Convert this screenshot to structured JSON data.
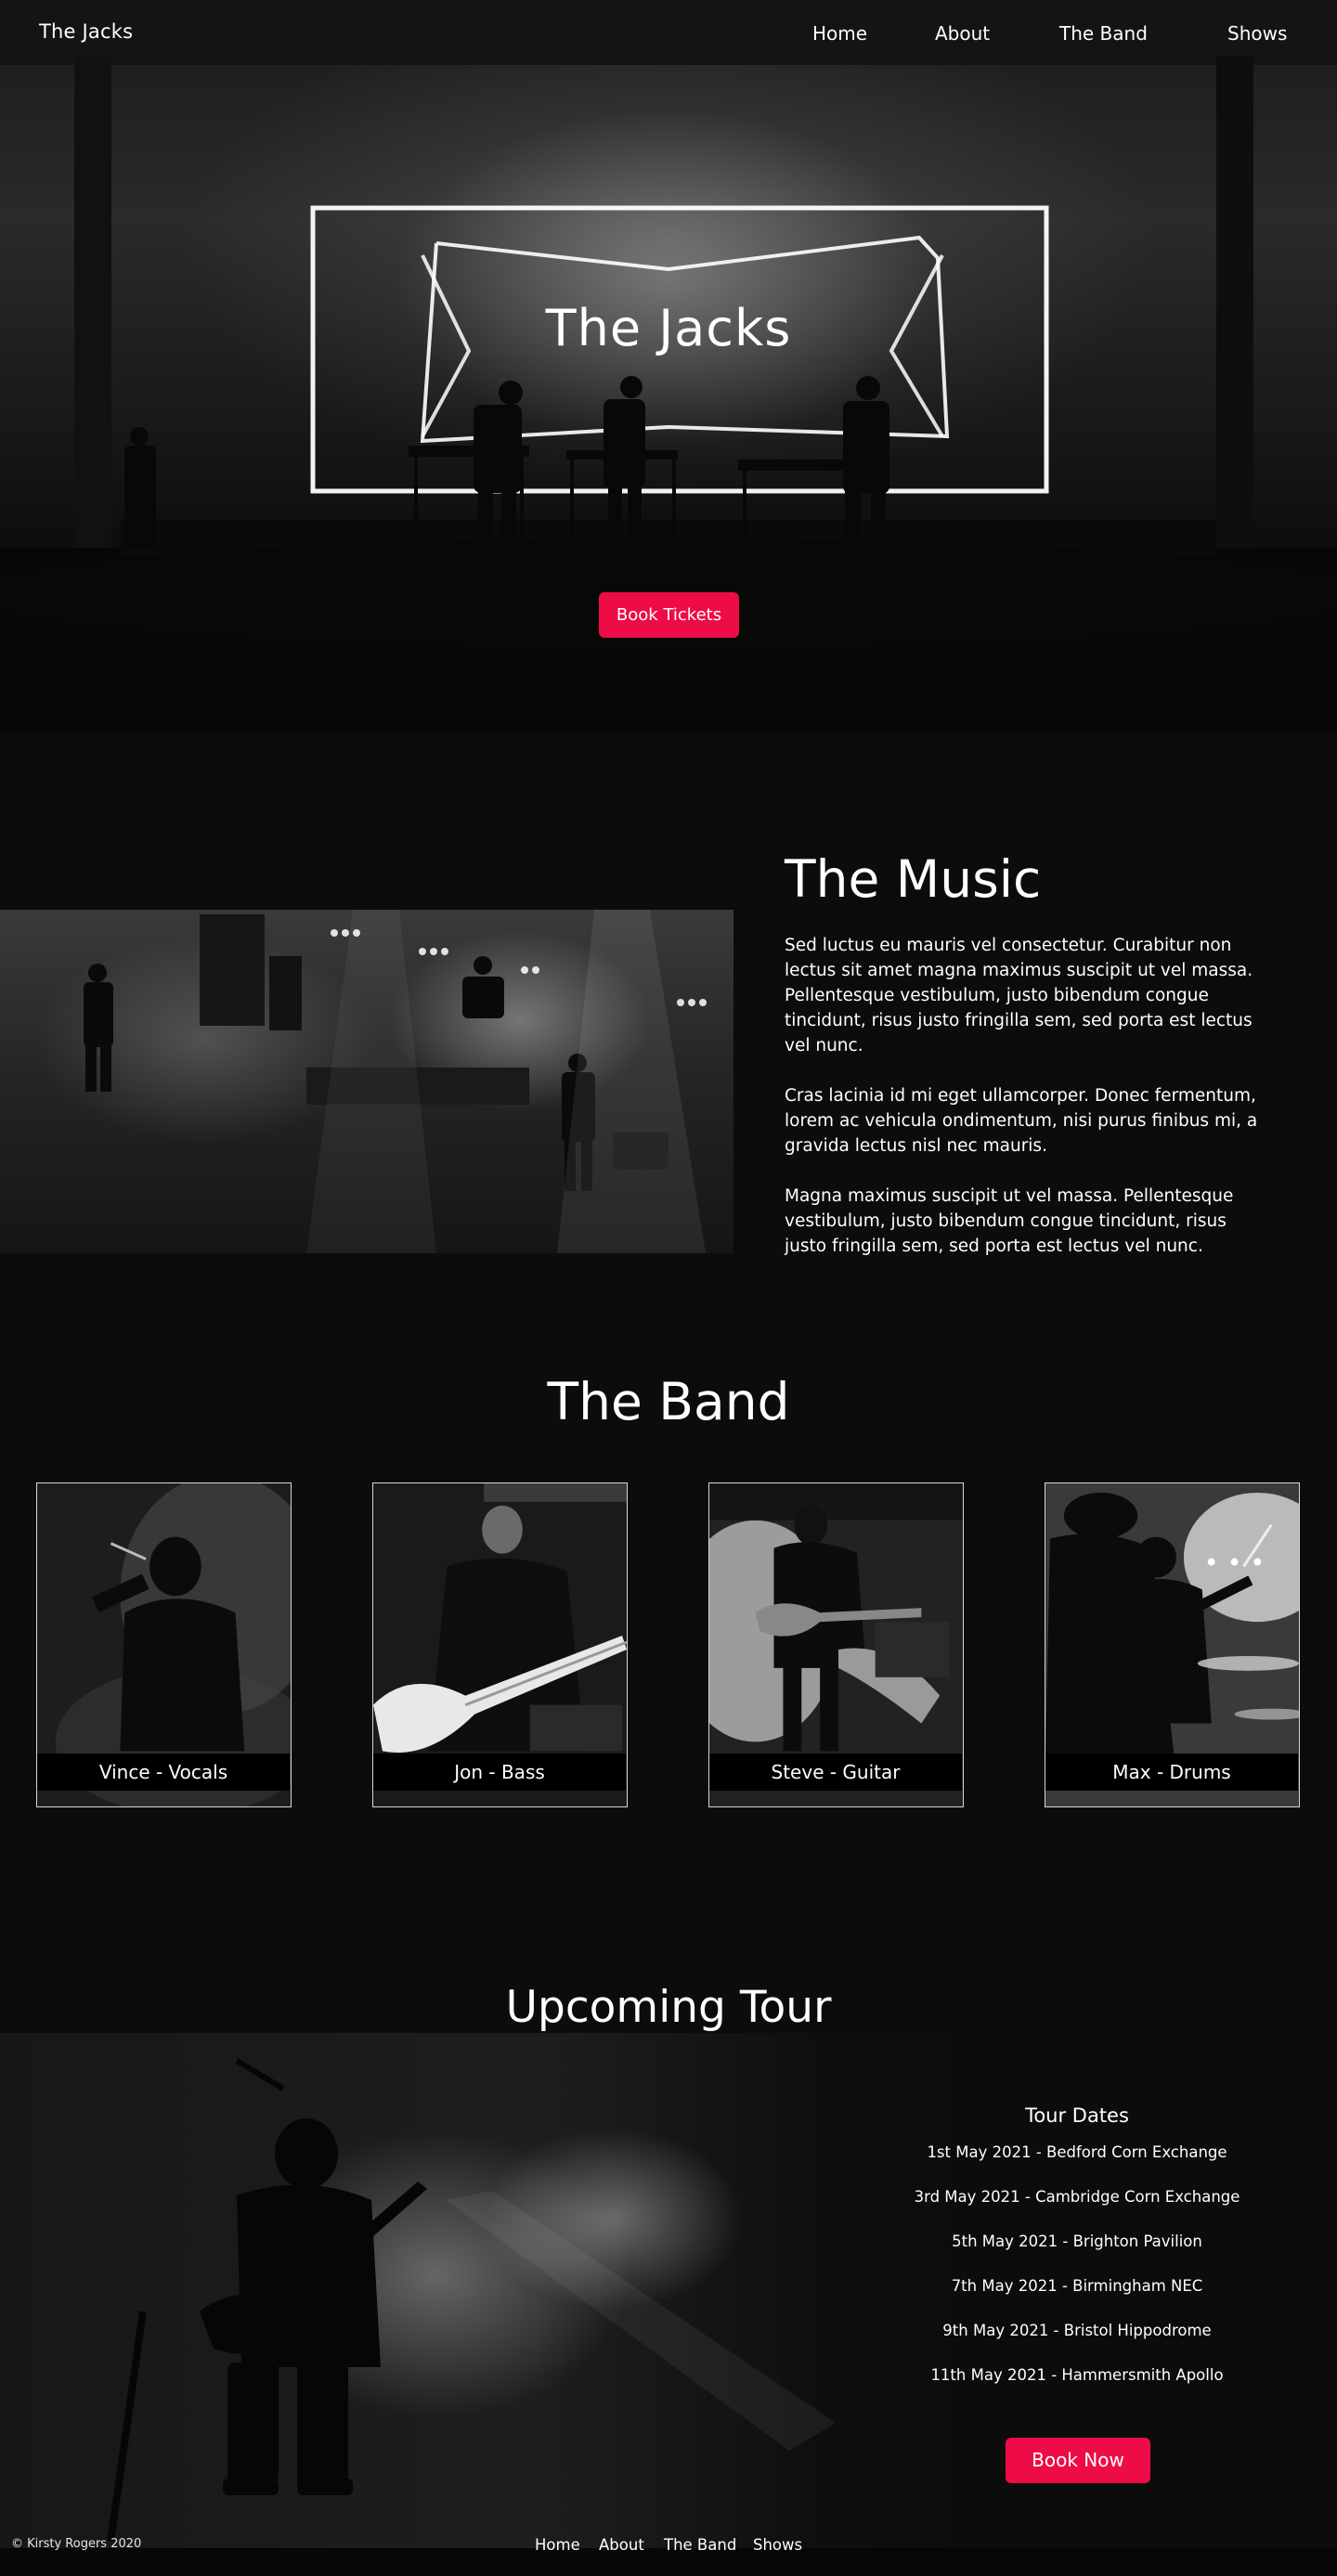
{
  "nav": {
    "brand": "The Jacks",
    "links": [
      "Home",
      "About",
      "The Band",
      "Shows"
    ]
  },
  "hero": {
    "title": "The Jacks",
    "button": "Book Tickets"
  },
  "music": {
    "title": "The Music",
    "paragraphs": [
      "Sed luctus eu mauris vel consectetur. Curabitur non lectus sit amet magna maximus suscipit ut vel massa. Pellentesque vestibulum, justo bibendum congue tincidunt, risus justo fringilla sem, sed porta est lectus vel nunc.",
      "Cras lacinia id mi eget ullamcorper. Donec fermentum, lorem ac vehicula ondimentum, nisi purus finibus mi, a gravida lectus nisl nec mauris.",
      "Magna maximus suscipit ut vel massa. Pellentesque vestibulum, justo bibendum congue tincidunt, risus justo fringilla sem, sed porta est lectus vel nunc."
    ]
  },
  "band": {
    "title": "The Band",
    "members": [
      {
        "label": "Vince - Vocals"
      },
      {
        "label": "Jon - Bass"
      },
      {
        "label": "Steve - Guitar"
      },
      {
        "label": "Max  - Drums"
      }
    ]
  },
  "tour": {
    "title": "Upcoming Tour",
    "heading": "Tour Dates",
    "dates": [
      "1st May 2021 - Bedford Corn Exchange",
      "3rd May 2021 - Cambridge Corn Exchange",
      "5th May 2021 - Brighton Pavilion",
      "7th May 2021 - Birmingham NEC",
      "9th May 2021 - Bristol Hippodrome",
      "11th May 2021 - Hammersmith Apollo"
    ],
    "button": "Book Now"
  },
  "footer": {
    "copyright": "© Kirsty Rogers 2020",
    "links": [
      "Home",
      "About",
      "The Band",
      "Shows"
    ]
  },
  "colors": {
    "background": "#0c0c0d",
    "accent": "#ee0c46",
    "text": "#ffffff"
  }
}
